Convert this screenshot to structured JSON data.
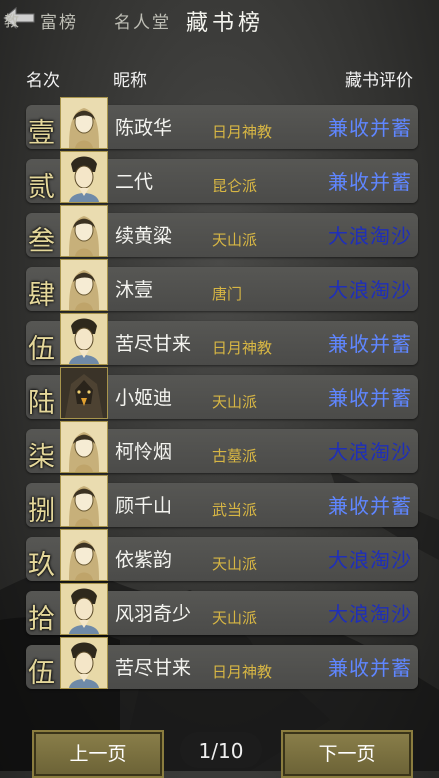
{
  "tabs": [
    {
      "label": "教"
    },
    {
      "label": "富榜"
    },
    {
      "label": "名人堂"
    },
    {
      "label": "藏书榜"
    }
  ],
  "headers": {
    "rank": "名次",
    "name": "昵称",
    "rating": "藏书评价"
  },
  "rows": [
    {
      "rank": "壹",
      "name": "陈政华",
      "sect": "日月神教",
      "rating": "兼收并蓄",
      "avatar": "female-avatar"
    },
    {
      "rank": "贰",
      "name": "二代",
      "sect": "昆仑派",
      "rating": "兼收并蓄",
      "avatar": "male-avatar"
    },
    {
      "rank": "叁",
      "name": "续黄粱",
      "sect": "天山派",
      "rating": "大浪淘沙",
      "avatar": "female-avatar"
    },
    {
      "rank": "肆",
      "name": "沐壹",
      "sect": "唐门",
      "rating": "大浪淘沙",
      "avatar": "female-avatar"
    },
    {
      "rank": "伍",
      "name": "苦尽甘来",
      "sect": "日月神教",
      "rating": "兼收并蓄",
      "avatar": "male-avatar"
    },
    {
      "rank": "陆",
      "name": "小姬迪",
      "sect": "天山派",
      "rating": "兼收并蓄",
      "avatar": "eagle-avatar"
    },
    {
      "rank": "柒",
      "name": "柯怜烟",
      "sect": "古墓派",
      "rating": "大浪淘沙",
      "avatar": "female-avatar"
    },
    {
      "rank": "捌",
      "name": "顾千山",
      "sect": "武当派",
      "rating": "兼收并蓄",
      "avatar": "female-avatar"
    },
    {
      "rank": "玖",
      "name": "依紫韵",
      "sect": "天山派",
      "rating": "大浪淘沙",
      "avatar": "female-avatar"
    },
    {
      "rank": "拾",
      "name": "风羽奇少",
      "sect": "天山派",
      "rating": "大浪淘沙",
      "avatar": "male-avatar"
    },
    {
      "rank": "伍",
      "name": "苦尽甘来",
      "sect": "日月神教",
      "rating": "兼收并蓄",
      "avatar": "male-avatar"
    }
  ],
  "pager": {
    "prev": "上一页",
    "page": "1/10",
    "next": "下一页"
  },
  "colors": {
    "rank": "#e4d79a",
    "sect": "#d7b644",
    "rating_high": "#5f86ff",
    "rating_low": "#1f2fb8"
  }
}
